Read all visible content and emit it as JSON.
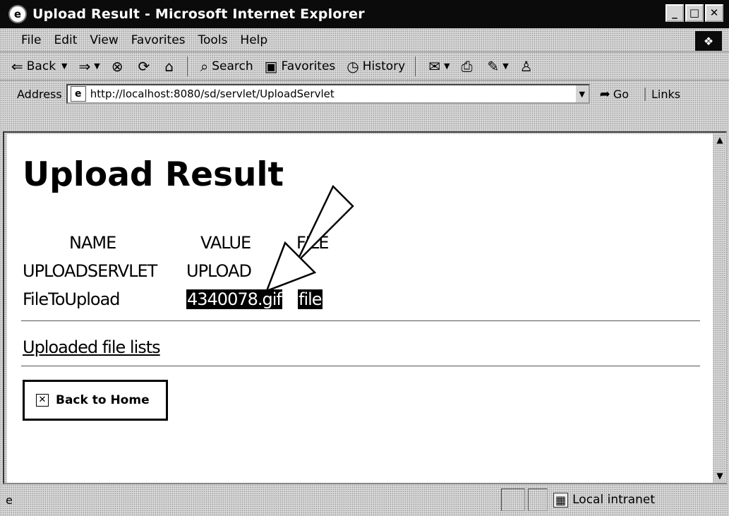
{
  "window": {
    "title": "Upload Result - Microsoft Internet Explorer"
  },
  "menu": [
    "File",
    "Edit",
    "View",
    "Favorites",
    "Tools",
    "Help"
  ],
  "toolbar": {
    "back": "Back",
    "search": "Search",
    "favorites": "Favorites",
    "history": "History"
  },
  "address": {
    "label": "Address",
    "url": "http://localhost:8080/sd/servlet/UploadServlet",
    "go": "Go",
    "links": "Links"
  },
  "page": {
    "title": "Upload Result",
    "columns": [
      "NAME",
      "VALUE",
      "FILE"
    ],
    "rows": [
      {
        "name": "UPLOADSERVLET",
        "value": "UPLOAD",
        "file": ""
      },
      {
        "name": "FileToUpload",
        "value": "4340078.gif",
        "file": "file"
      }
    ],
    "link": "Uploaded file lists",
    "back_button": "Back to Home"
  },
  "status": {
    "zone": "Local intranet"
  }
}
